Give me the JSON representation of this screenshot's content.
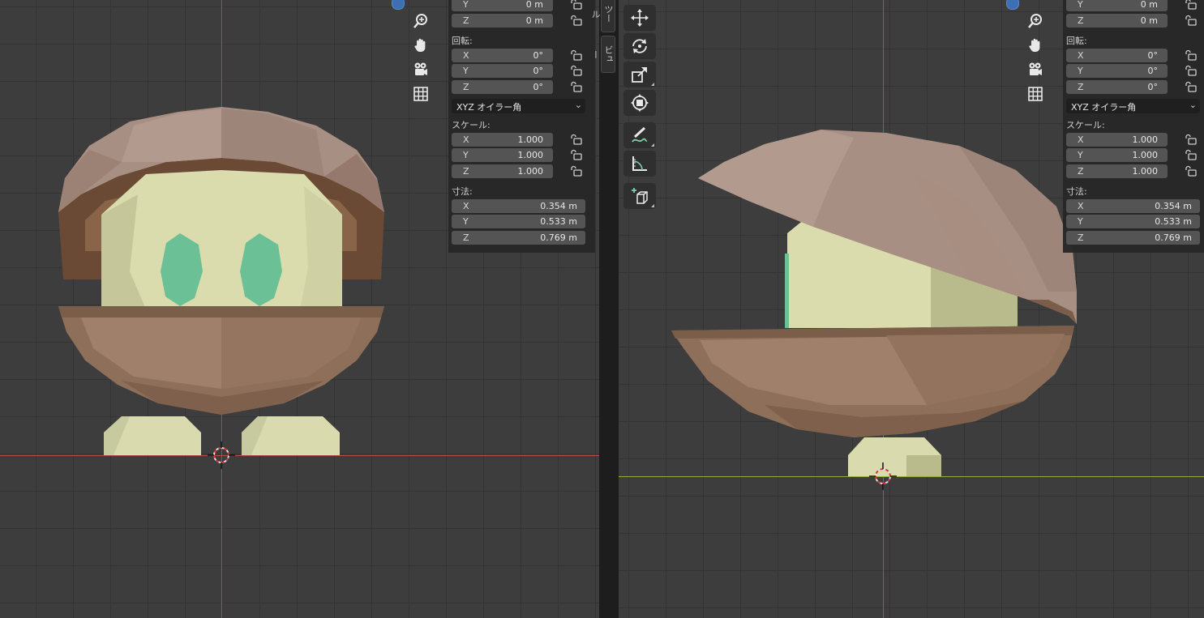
{
  "panel": {
    "location_y": "0 m",
    "location_z": "0 m",
    "rotation_label": "回転:",
    "rotation": {
      "x": "0°",
      "y": "0°",
      "z": "0°"
    },
    "rotation_mode": "XYZ オイラー角",
    "scale_label": "スケール:",
    "scale": {
      "x": "1.000",
      "y": "1.000",
      "z": "1.000"
    },
    "dimensions_label": "寸法:",
    "dimensions": {
      "x": "0.354 m",
      "y": "0.533 m",
      "z": "0.769 m"
    },
    "axis_x": "X",
    "axis_y": "Y",
    "axis_z": "Z"
  },
  "tabs": {
    "tool": "ツール",
    "view": "ビュー"
  },
  "icons": {
    "navigation": [
      "zoom-icon",
      "pan-hand-icon",
      "camera-icon",
      "grid-icon"
    ],
    "tools": [
      "move-icon",
      "rotate-icon",
      "scale-icon",
      "transform-icon",
      "annotate-icon",
      "measure-icon",
      "add-cube-icon"
    ]
  },
  "colors": {
    "shell_top": "#a88f83",
    "shell_bottom": "#8d6f5a",
    "body": "#d9dbae",
    "eyes": "#6cc095",
    "x_axis": "#b84a4a",
    "y_axis": "#8fb035",
    "z_axis": "#4a6fa5"
  }
}
